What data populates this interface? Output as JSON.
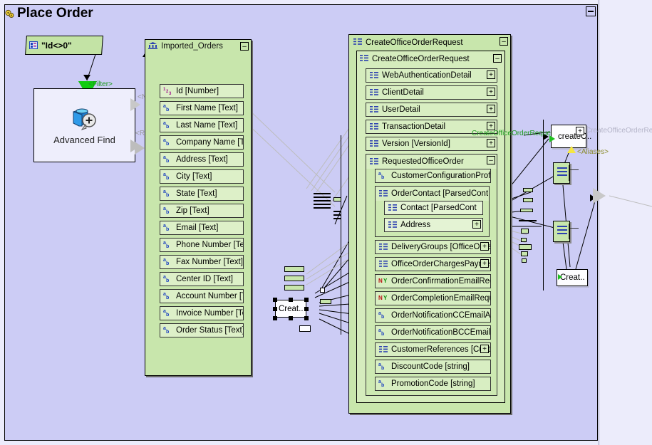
{
  "window": {
    "title": "Place Order",
    "title_icon": "gears-icon",
    "collapse_label": "–"
  },
  "filter_node": {
    "icon": "filter-expression-icon",
    "expression": "\"Id<>0\"",
    "connector_label": "<Filter>"
  },
  "advanced_find": {
    "label": "Advanced Find",
    "icon": "advanced-find-icon",
    "ports": [
      {
        "label": "<None>"
      },
      {
        "label": "<Records>"
      }
    ]
  },
  "imported_orders": {
    "title": "Imported_Orders",
    "icon": "table-icon",
    "collapse_label": "–",
    "fields": [
      {
        "icon": "number-type-icon",
        "type": "num",
        "label": "Id [Number]"
      },
      {
        "icon": "text-type-icon",
        "type": "ab",
        "label": "First Name [Text]"
      },
      {
        "icon": "text-type-icon",
        "type": "ab",
        "label": "Last Name [Text]"
      },
      {
        "icon": "text-type-icon",
        "type": "ab",
        "label": "Company Name [Tex"
      },
      {
        "icon": "text-type-icon",
        "type": "ab",
        "label": "Address [Text]"
      },
      {
        "icon": "text-type-icon",
        "type": "ab",
        "label": "City [Text]"
      },
      {
        "icon": "text-type-icon",
        "type": "ab",
        "label": "State [Text]"
      },
      {
        "icon": "text-type-icon",
        "type": "ab",
        "label": "Zip [Text]"
      },
      {
        "icon": "text-type-icon",
        "type": "ab",
        "label": "Email [Text]"
      },
      {
        "icon": "text-type-icon",
        "type": "ab",
        "label": "Phone Number [Text"
      },
      {
        "icon": "text-type-icon",
        "type": "ab",
        "label": "Fax Number [Text]"
      },
      {
        "icon": "text-type-icon",
        "type": "ab",
        "label": "Center ID [Text]"
      },
      {
        "icon": "text-type-icon",
        "type": "ab",
        "label": "Account Number [Te"
      },
      {
        "icon": "text-type-icon",
        "type": "ab",
        "label": "Invoice Number [Tex"
      },
      {
        "icon": "text-type-icon",
        "type": "ab",
        "label": "Order Status [Text]"
      }
    ]
  },
  "request_tree": {
    "title": "CreateOfficeOrderRequest",
    "icon": "xml-tree-icon",
    "collapse_label": "–",
    "root": {
      "label": "CreateOfficeOrderRequest",
      "icon": "xml-tree-icon",
      "collapse_label": "–"
    },
    "nodes": [
      {
        "icon": "xml-tree-icon",
        "type": "tree",
        "label": "WebAuthenticationDetail",
        "btn": "+"
      },
      {
        "icon": "xml-tree-icon",
        "type": "tree",
        "label": "ClientDetail",
        "btn": "+"
      },
      {
        "icon": "xml-tree-icon",
        "type": "tree",
        "label": "UserDetail",
        "btn": "+"
      },
      {
        "icon": "xml-tree-icon",
        "type": "tree",
        "label": "TransactionDetail",
        "btn": "+"
      },
      {
        "icon": "xml-tree-icon",
        "type": "tree",
        "label": "Version [VersionId]",
        "btn": "+"
      }
    ],
    "requested_order": {
      "label": "RequestedOfficeOrder",
      "icon": "xml-tree-icon",
      "btn": "–",
      "children": [
        {
          "icon": "text-type-icon",
          "type": "ab",
          "label": "CustomerConfigurationProfi",
          "btn": ""
        },
        {
          "icon": "xml-tree-icon",
          "type": "tree",
          "label": "OrderContact [ParsedCont",
          "btn": "",
          "group": true,
          "children": [
            {
              "icon": "xml-tree-icon",
              "type": "tree",
              "label": "Contact [ParsedCont",
              "btn": ""
            },
            {
              "icon": "xml-tree-icon",
              "type": "tree",
              "label": "Address",
              "btn": "+"
            }
          ]
        },
        {
          "icon": "xml-tree-icon",
          "type": "tree",
          "label": "DeliveryGroups [OfficeOrde",
          "btn": "+"
        },
        {
          "icon": "xml-tree-icon",
          "type": "tree",
          "label": "OfficeOrderChargesPaymen",
          "btn": "+"
        },
        {
          "icon": "boolean-type-icon",
          "type": "ny",
          "label": "OrderConfirmationEmailReq",
          "btn": ""
        },
        {
          "icon": "boolean-type-icon",
          "type": "ny",
          "label": "OrderCompletionEmailRequ",
          "btn": ""
        },
        {
          "icon": "text-type-icon",
          "type": "ab",
          "label": "OrderNotificationCCEmailA",
          "btn": ""
        },
        {
          "icon": "text-type-icon",
          "type": "ab",
          "label": "OrderNotificationBCCEmail",
          "btn": ""
        },
        {
          "icon": "xml-tree-icon",
          "type": "tree",
          "label": "CustomerReferences [Cust",
          "btn": "+"
        },
        {
          "icon": "text-type-icon",
          "type": "ab",
          "label": "DiscountCode [string]",
          "btn": ""
        },
        {
          "icon": "text-type-icon",
          "type": "ab",
          "label": "PromotionCode [string]",
          "btn": ""
        }
      ]
    }
  },
  "right_side": {
    "request_label": "CreateOfficeOrderRequest",
    "ghost_label": "CreateOfficeOrderRe[",
    "create_node": {
      "label": "createO..",
      "btn": "+"
    },
    "aliases_label": "<Aliases>",
    "create_bottom": {
      "label": "Creat.."
    }
  },
  "selected_node": {
    "label": "Creat.."
  },
  "colors": {
    "canvas": "#ccccf5",
    "page": "#ececfb",
    "green_box": "#c8e6ac",
    "green_field": "#ddf0c8",
    "green_label": "#1a9a1a",
    "grey_label": "#9a9a9a",
    "wire": "#000000",
    "ghost_wire": "#bdbdbd"
  }
}
